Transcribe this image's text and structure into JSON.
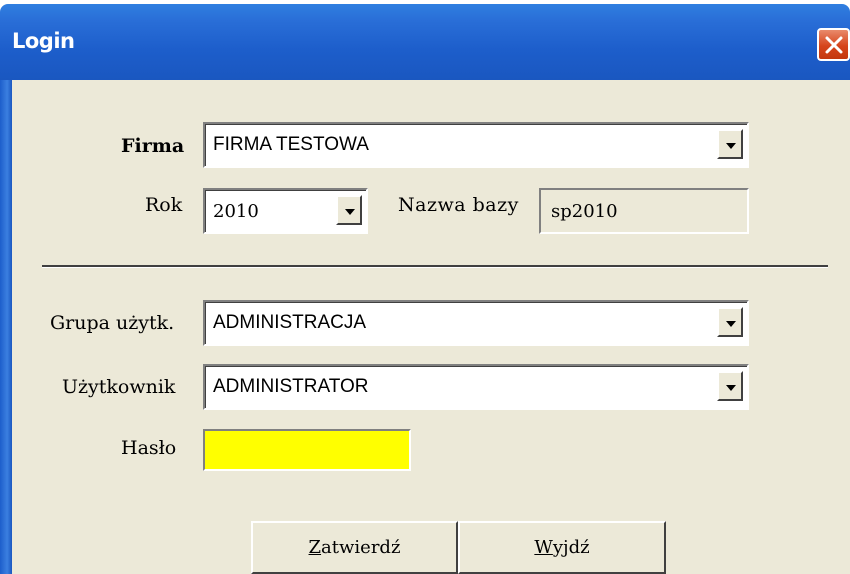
{
  "window": {
    "title": "Login"
  },
  "colors": {
    "titlebar": "#1d5ecb",
    "dialog_bg": "#ece9d8",
    "password_bg": "#ffff00",
    "close_button": "#d6451c"
  },
  "form": {
    "firma": {
      "label": "Firma",
      "value": "FIRMA TESTOWA"
    },
    "rok": {
      "label": "Rok",
      "value": "2010"
    },
    "nazwa_bazy": {
      "label": "Nazwa bazy",
      "value": "sp2010"
    },
    "grupa": {
      "label": "Grupa użytk.",
      "value": "ADMINISTRACJA"
    },
    "uzytkownik": {
      "label": "Użytkownik",
      "value": "ADMINISTRATOR"
    },
    "haslo": {
      "label": "Hasło",
      "value": ""
    }
  },
  "buttons": {
    "confirm": {
      "mnemonic": "Z",
      "rest": "atwierdź"
    },
    "exit": {
      "mnemonic": "W",
      "rest": "yjdź"
    }
  }
}
